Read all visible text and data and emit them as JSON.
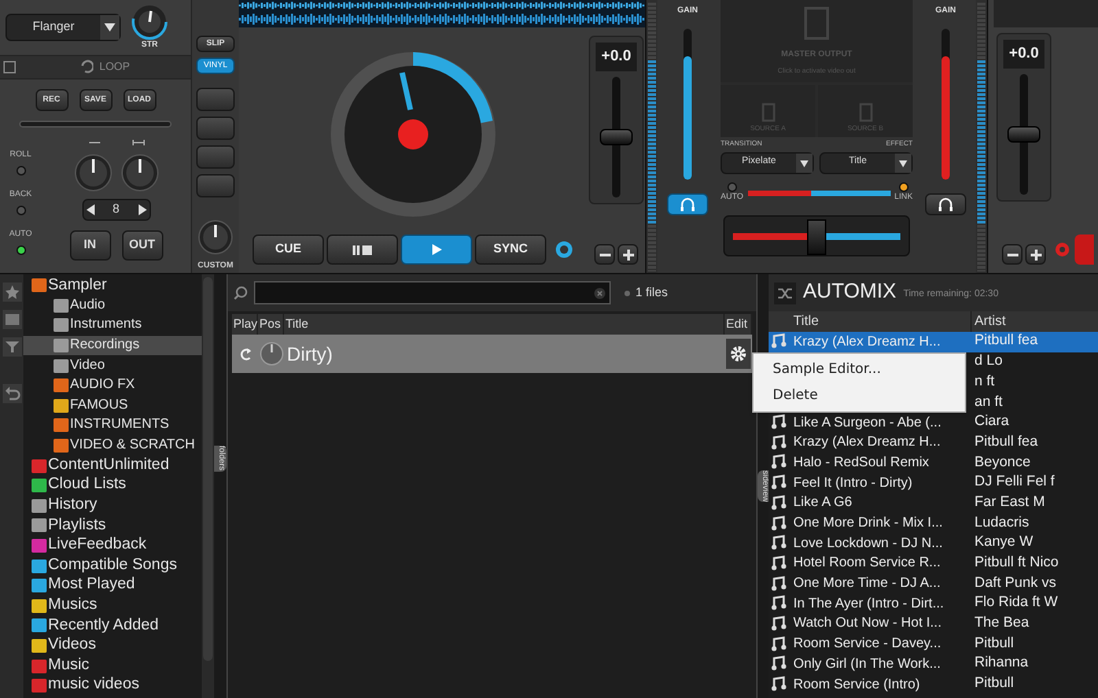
{
  "left_deck": {
    "effect_dropdown": "Flanger",
    "effect_knob_label": "STR",
    "loop_header": "LOOP",
    "loop_buttons": [
      "REC",
      "SAVE",
      "LOAD"
    ],
    "pads_modes": [
      {
        "label": "ROLL",
        "on": false
      },
      {
        "label": "BACK",
        "on": false
      },
      {
        "label": "AUTO",
        "on": true
      }
    ],
    "loop_size": "8",
    "in_label": "IN",
    "out_label": "OUT",
    "mode_buttons": [
      {
        "label": "SLIP",
        "selected": false
      },
      {
        "label": "VINYL",
        "selected": true
      }
    ],
    "custom_label": "CUSTOM",
    "transport": [
      {
        "kind": "text",
        "label": "CUE",
        "selected": false
      },
      {
        "kind": "pause",
        "selected": false
      },
      {
        "kind": "play",
        "selected": true
      },
      {
        "kind": "text",
        "label": "SYNC",
        "selected": false
      }
    ],
    "pitch": {
      "reading": "+0.0",
      "level": 0.5
    }
  },
  "mixer": {
    "channels": [
      {
        "gain_label": "GAIN",
        "level": 0.82,
        "headphone_selected": true
      },
      {
        "gain_label": "GAIN",
        "level": 0.82,
        "headphone_selected": false
      }
    ],
    "video": {
      "title": "MASTER OUTPUT",
      "hint": "Click to activate video out",
      "sources": [
        "SOURCE A",
        "SOURCE B"
      ]
    },
    "transition_label": "TRANSITION",
    "effect_label": "EFFECT",
    "transition": "Pixelate",
    "effect": "Title",
    "video_fader": {
      "level": 0.45
    },
    "leds": [
      {
        "label": "AUTO",
        "on": false
      },
      {
        "label": "LINK",
        "on": true
      }
    ],
    "crossfader": {
      "level": 0.5
    }
  },
  "right_deck": {
    "pitch": {
      "reading": "+0.0",
      "level": 0.5
    }
  },
  "sidebar": {
    "items": [
      {
        "label": "Sampler",
        "color": "#e0661a",
        "selected": false,
        "children": [
          {
            "label": "Audio",
            "color": "#9a9a9a",
            "selected": false
          },
          {
            "label": "Instruments",
            "color": "#9a9a9a",
            "selected": false
          },
          {
            "label": "Recordings",
            "color": "#9a9a9a",
            "selected": true
          },
          {
            "label": "Video",
            "color": "#9a9a9a",
            "selected": false
          },
          {
            "label": "AUDIO FX",
            "color": "#e0661a",
            "selected": false
          },
          {
            "label": "FAMOUS",
            "color": "#e0a81a",
            "selected": false
          },
          {
            "label": "INSTRUMENTS",
            "color": "#e0661a",
            "selected": false
          },
          {
            "label": "VIDEO & SCRATCH",
            "color": "#e0661a",
            "selected": false
          }
        ]
      },
      {
        "label": "ContentUnlimited",
        "color": "#d8262b",
        "selected": false
      },
      {
        "label": "Cloud Lists",
        "color": "#2eb84a",
        "selected": false
      },
      {
        "label": "History",
        "color": "#9a9a9a",
        "selected": false
      },
      {
        "label": "Playlists",
        "color": "#9a9a9a",
        "selected": false
      },
      {
        "label": "LiveFeedback",
        "color": "#d42aa0",
        "selected": false
      },
      {
        "label": "Compatible Songs",
        "color": "#2aa8e0",
        "selected": false
      },
      {
        "label": "Most Played",
        "color": "#2aa8e0",
        "selected": false
      },
      {
        "label": "Musics",
        "color": "#e0b81a",
        "selected": false
      },
      {
        "label": "Recently Added",
        "color": "#2aa8e0",
        "selected": false
      },
      {
        "label": "Videos",
        "color": "#e0b81a",
        "selected": false
      },
      {
        "label": "Music",
        "color": "#d8262b",
        "selected": false
      },
      {
        "label": "music videos",
        "color": "#d8262b",
        "selected": false
      }
    ]
  },
  "folders_tab": "folders",
  "browser": {
    "file_count": "1 files",
    "columns": [
      "Play",
      "Pos",
      "Title",
      "Edit"
    ],
    "rows": [
      {
        "title": "Dirty)",
        "selected": true
      }
    ]
  },
  "context_menu": [
    "Sample Editor...",
    "Delete"
  ],
  "sideview_tab": "sideview",
  "automix": {
    "title": "AUTOMIX",
    "time_remaining": "Time remaining: 02:30",
    "columns": [
      "Title",
      "Artist"
    ],
    "rows": [
      {
        "title": "Krazy (Alex Dreamz H...",
        "artist": "Pitbull fea",
        "selected": true
      },
      {
        "artist": "d Lo",
        "selected": false
      },
      {
        "artist": "n ft",
        "selected": false
      },
      {
        "artist": "an ft",
        "selected": false
      },
      {
        "title": "Like A Surgeon - Abe (...",
        "artist": "Ciara",
        "selected": false
      },
      {
        "title": "Krazy (Alex Dreamz H...",
        "artist": "Pitbull fea",
        "selected": false
      },
      {
        "title": "Halo - RedSoul Remix",
        "artist": "Beyonce",
        "selected": false
      },
      {
        "title": "Feel It (Intro - Dirty)",
        "artist": "DJ Felli Fel f",
        "selected": false
      },
      {
        "title": "Like A G6",
        "artist": "Far East M",
        "selected": false
      },
      {
        "title": "One More Drink - Mix I...",
        "artist": "Ludacris",
        "selected": false
      },
      {
        "title": "Love Lockdown - DJ N...",
        "artist": "Kanye W",
        "selected": false
      },
      {
        "title": "Hotel Room Service R...",
        "artist": "Pitbull ft Nico",
        "selected": false
      },
      {
        "title": "One More Time - DJ A...",
        "artist": "Daft Punk vs",
        "selected": false
      },
      {
        "title": "In The Ayer (Intro - Dirt...",
        "artist": "Flo Rida ft W",
        "selected": false
      },
      {
        "title": "Watch Out Now - Hot I...",
        "artist": "The Bea",
        "selected": false
      },
      {
        "title": "Room Service - Davey...",
        "artist": "Pitbull",
        "selected": false
      },
      {
        "title": "Only Girl (In The Work...",
        "artist": "Rihanna",
        "selected": false
      },
      {
        "title": "Room Service (Intro)",
        "artist": "Pitbull",
        "selected": false
      }
    ]
  }
}
